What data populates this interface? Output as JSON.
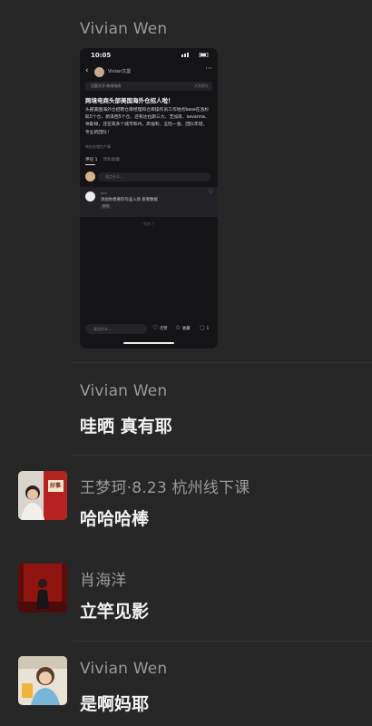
{
  "messages": [
    {
      "name": "Vivian Wen"
    },
    {
      "name": "Vivian Wen",
      "text": "哇晒 真有耶"
    },
    {
      "name": "王梦珂·8.23 杭州线下课",
      "text": "哈哈哈棒",
      "avatar_badge": "好事"
    },
    {
      "name": "肖海洋",
      "text": "立竿见影"
    },
    {
      "name": "Vivian Wen",
      "text": "是啊妈耶"
    }
  ],
  "phone": {
    "time": "10:05",
    "author": "Vivian文曼",
    "topic": "话题文学·跨境电商",
    "topic_right": "大家都在",
    "title": "跨境电商头部美国海外仓招人啦！",
    "body": "头部美国海外仓招聘仓库经理和仓库操作员工作地点base在洛杉矶5个仓、新泽西5个仓、还有达拉斯三大、芝加哥、savanna、休斯顿，还在等多个城市和州。高福利、五险一金、团队年轻、专业的团队！",
    "link": "转自仓储生产事",
    "tab_comments": "评论 1",
    "tab_other": "赞和收藏",
    "comment_placeholder": "说点什么...",
    "card_name": "xxx",
    "card_text": "添加你想要的作品入场 查看数据",
    "card_tag": "服饰",
    "end_text": "- 到底了 -",
    "bottom_placeholder": "说点什么...",
    "like_label": "点赞",
    "fav_label": "收藏",
    "comment_count": "1"
  }
}
